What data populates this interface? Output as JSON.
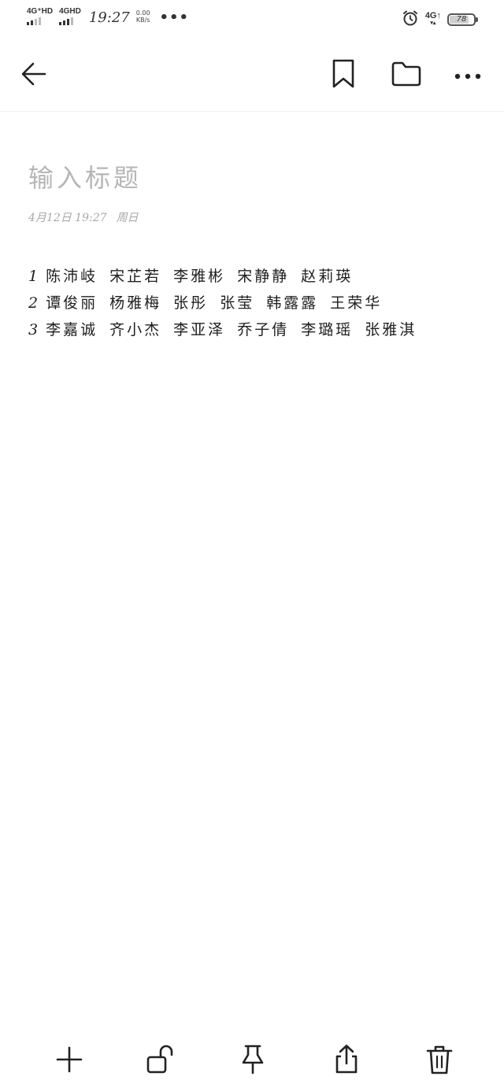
{
  "status_bar": {
    "network1": "4G⁺HD",
    "network2": "4GHD",
    "time": "19:27",
    "speed_value": "0.00",
    "speed_unit": "KB/s",
    "more": "•••",
    "data_network": "4G↑",
    "data_arrows": "▾▴",
    "battery": "78"
  },
  "toolbar": {
    "back_icon": "back-arrow-icon",
    "bookmark_icon": "bookmark-icon",
    "folder_icon": "folder-icon",
    "more_icon": "more-horizontal-icon"
  },
  "note": {
    "title_placeholder": "输入标题",
    "date": "4月12日 19:27",
    "weekday": "周日",
    "lines": [
      {
        "num": "1",
        "names": "陈沛岐 宋芷若 李雅彬 宋静静 赵莉瑛"
      },
      {
        "num": "2",
        "names": "谭俊丽 杨雅梅 张彤 张莹 韩露露 王荣华"
      },
      {
        "num": "3",
        "names": "李嘉诚 齐小杰 李亚泽 乔子倩 李璐瑶 张雅淇"
      }
    ]
  },
  "bottom_toolbar": {
    "icons": [
      "add-icon",
      "unlock-icon",
      "pin-icon",
      "share-icon",
      "delete-icon"
    ]
  },
  "colors": {
    "background": "#ffffff",
    "icon": "#222222",
    "placeholder": "#b6b6b6",
    "meta": "#a8a8a8"
  }
}
